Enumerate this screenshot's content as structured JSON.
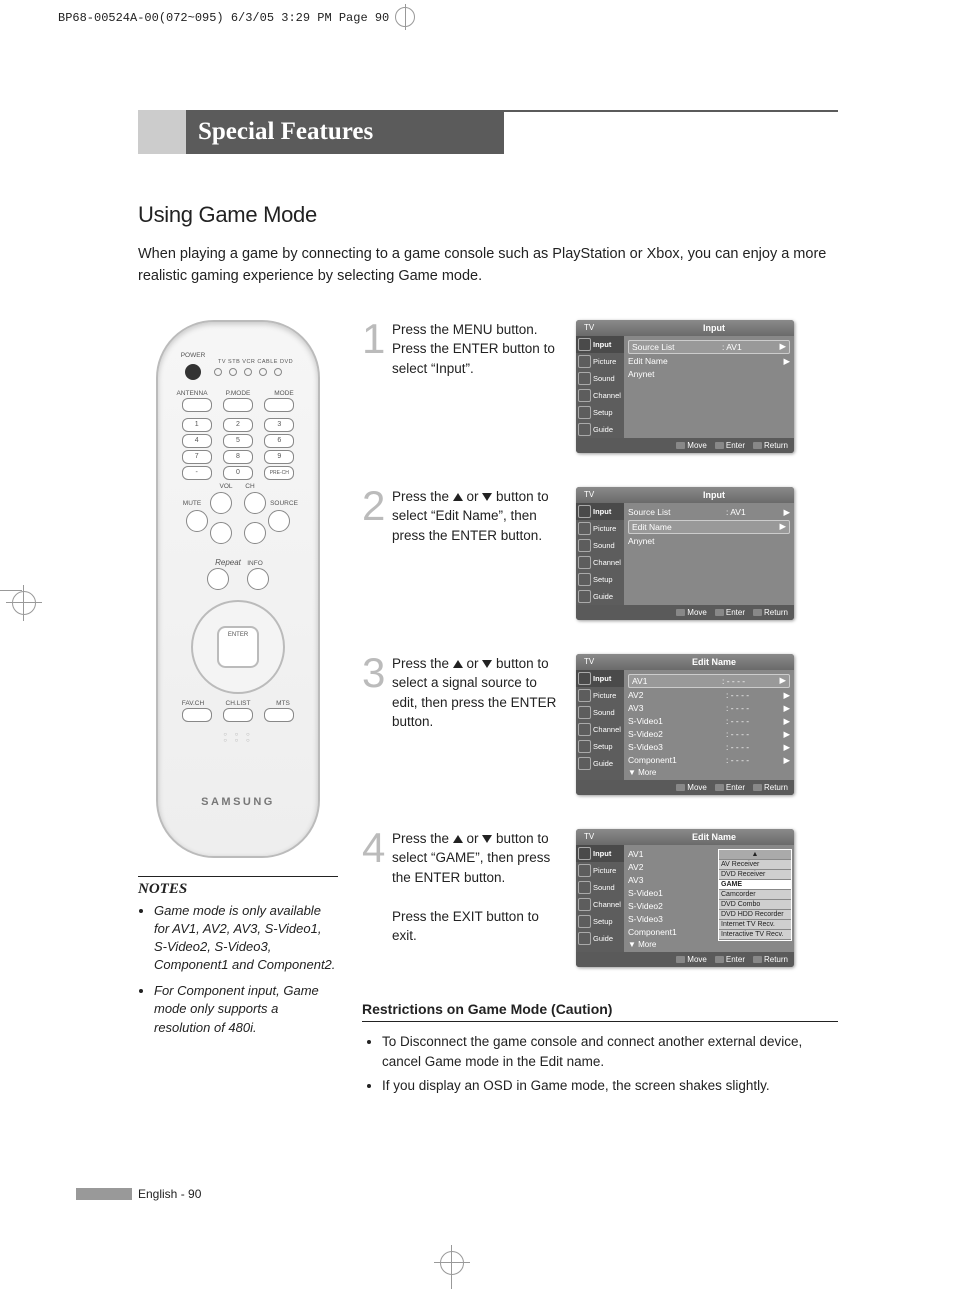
{
  "print": {
    "header": "BP68-00524A-00(072~095)  6/3/05  3:29 PM  Page 90"
  },
  "title": "Special Features",
  "section": "Using Game Mode",
  "intro": "When playing a game by connecting to a game console such as PlayStation or Xbox, you can enjoy a more realistic gaming experience by selecting Game mode.",
  "remote": {
    "power": "POWER",
    "toprow": "TV  STB  VCR  CABLE  DVD",
    "r1": [
      "ANTENNA",
      "P.MODE",
      "MODE"
    ],
    "prech": "PRE-CH",
    "r2": [
      "VOL",
      "CH"
    ],
    "r3": [
      "MUTE",
      "SOURCE"
    ],
    "repeat": "Repeat",
    "info": "INFO",
    "enter": "ENTER",
    "r4": [
      "FAV.CH",
      "CH.LIST",
      "MTS"
    ],
    "brand": "SAMSUNG"
  },
  "notes": {
    "heading": "NOTES",
    "items": [
      "Game mode is only available for AV1, AV2, AV3, S-Video1, S-Video2, S-Video3, Component1 and Component2.",
      "For Component input, Game mode only supports a resolution of 480i."
    ]
  },
  "steps": [
    {
      "n": "1",
      "text": "Press the MENU button. Press the ENTER button to select “Input”."
    },
    {
      "n": "2",
      "pre": "Press the ",
      "mid": " or ",
      "post": " button to select “Edit Name”, then press the ENTER button."
    },
    {
      "n": "3",
      "pre": "Press the ",
      "mid": " or ",
      "post": " button to select a signal source to edit, then press the ENTER button."
    },
    {
      "n": "4",
      "pre": "Press the ",
      "mid": " or ",
      "post": " button to select “GAME”, then press the ENTER button.",
      "exit": "Press the EXIT button to exit."
    }
  ],
  "osd": {
    "tv": "TV",
    "titleInput": "Input",
    "titleEdit": "Edit Name",
    "side": [
      "Input",
      "Picture",
      "Sound",
      "Channel",
      "Setup",
      "Guide"
    ],
    "input": [
      {
        "k": "Source List",
        "v": ": AV1"
      },
      {
        "k": "Edit Name",
        "v": ""
      },
      {
        "k": "Anynet",
        "v": ""
      }
    ],
    "edit": [
      "AV1",
      "AV2",
      "AV3",
      "S-Video1",
      "S-Video2",
      "S-Video3",
      "Component1"
    ],
    "dash": ": - - - -",
    "more": "▼ More",
    "popup": [
      "AV Receiver",
      "DVD Receiver",
      "GAME",
      "Camcorder",
      "DVD Combo",
      "DVD HDD Recorder",
      "Internet TV Recv.",
      "Interactive TV Recv."
    ],
    "ftr": [
      "Move",
      "Enter",
      "Return"
    ]
  },
  "restrictions": {
    "heading": "Restrictions on Game Mode (Caution)",
    "items": [
      "To Disconnect the game console and connect another external device, cancel Game mode in the Edit name.",
      "If you display an OSD in Game mode, the screen shakes slightly."
    ]
  },
  "footer": "English - 90"
}
